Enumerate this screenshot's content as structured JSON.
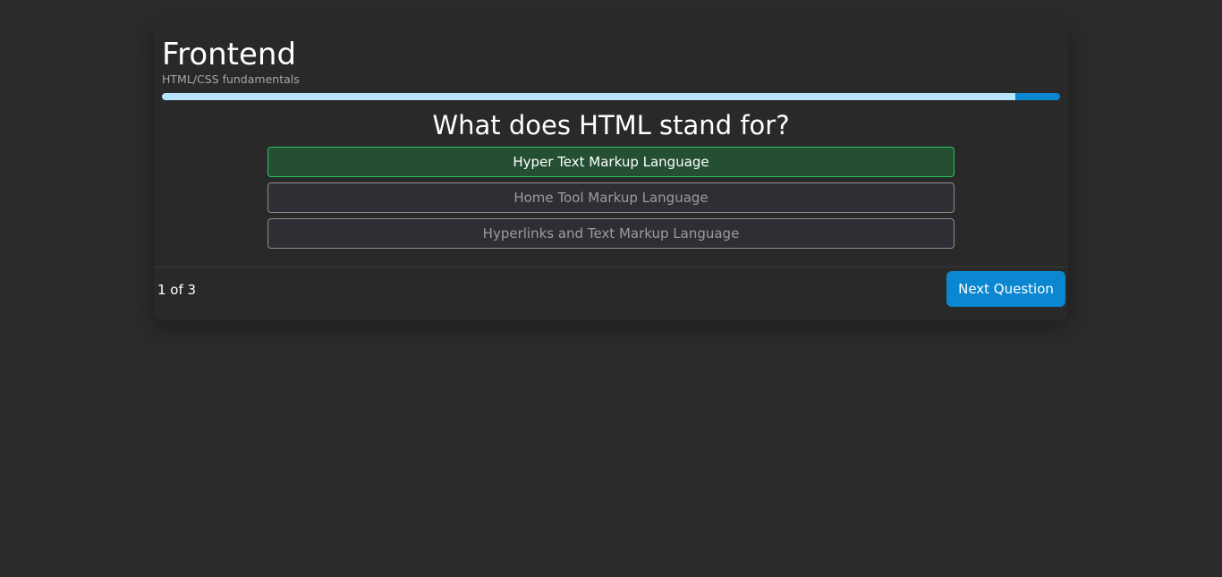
{
  "quiz": {
    "title": "Frontend",
    "subtitle": "HTML/CSS fundamentals",
    "progress_fraction": 0.95,
    "question": "What does HTML stand for?",
    "options": [
      {
        "label": "Hyper Text Markup Language",
        "selected": true
      },
      {
        "label": "Home Tool Markup Language",
        "selected": false
      },
      {
        "label": "Hyperlinks and Text Markup Language",
        "selected": false
      }
    ],
    "counter": "1 of 3",
    "next_label": "Next Question"
  },
  "colors": {
    "background": "#2b2b2b",
    "card": "#292929",
    "accent": "#0b86d0",
    "progress_fill": "#b9e3fb",
    "selected_border": "#22c55e",
    "selected_background": "#244f33"
  }
}
